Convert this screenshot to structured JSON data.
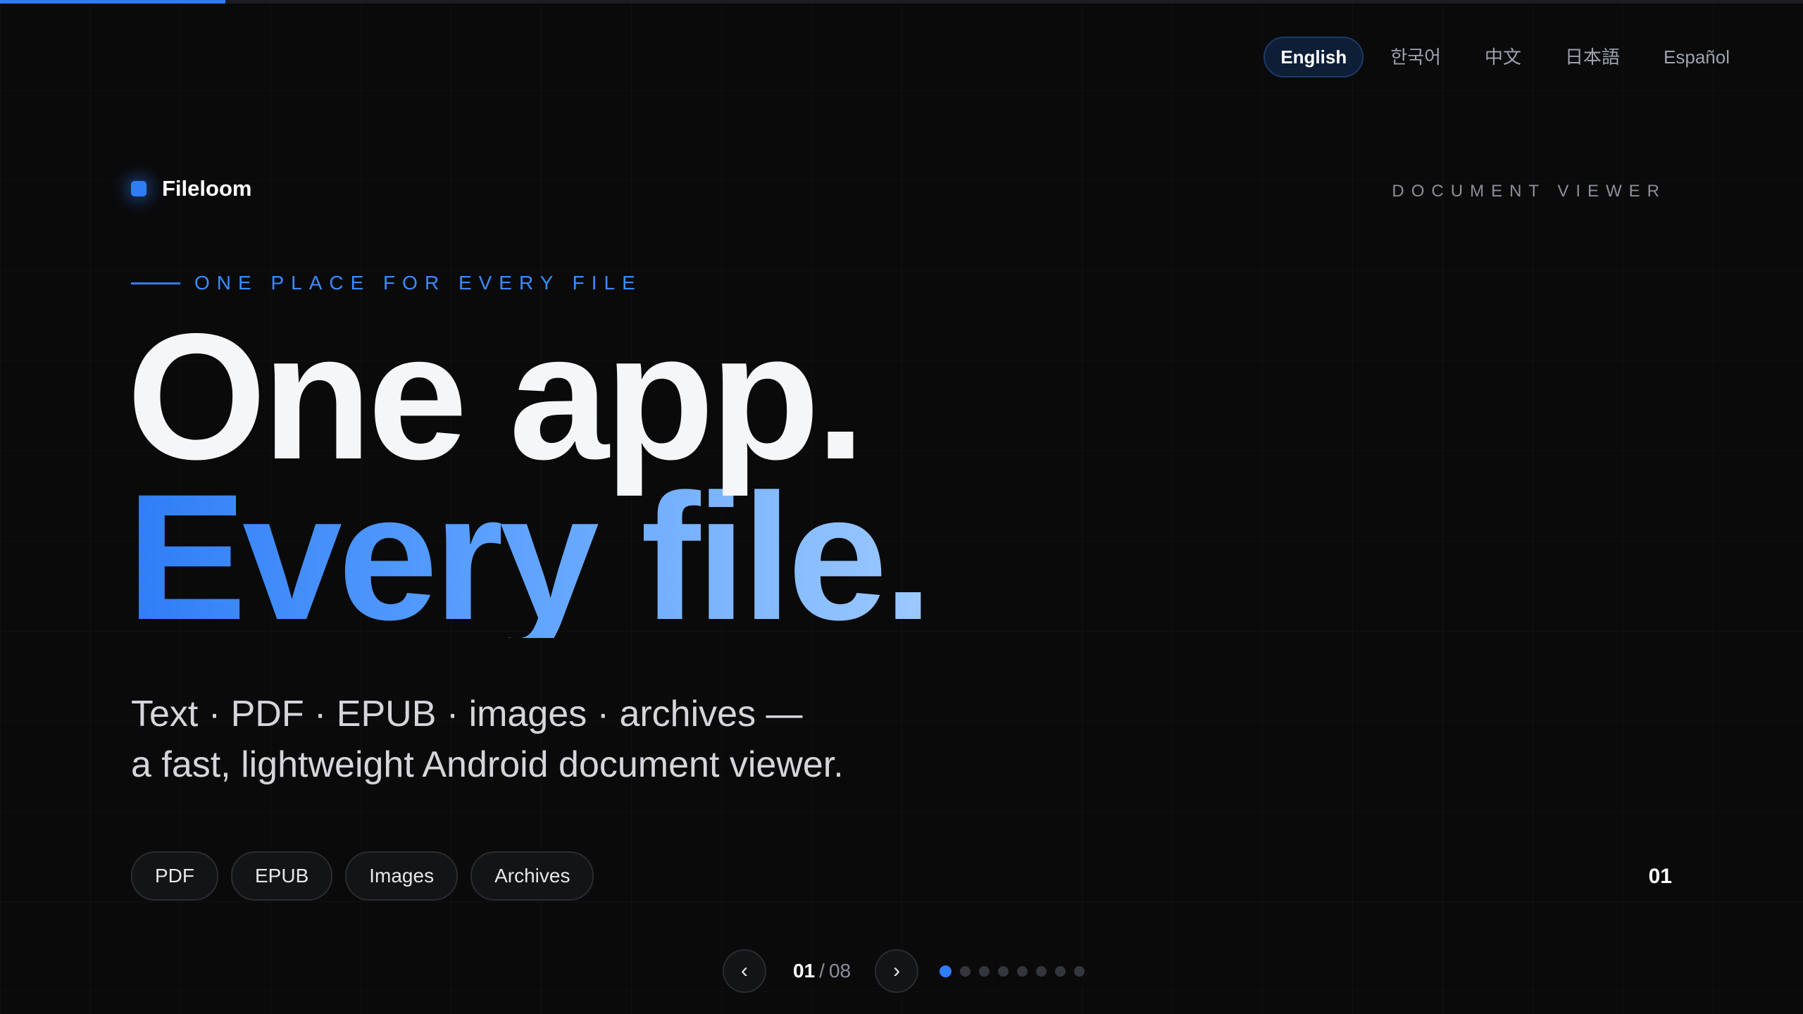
{
  "progress": {
    "fraction": 0.125
  },
  "languages": [
    {
      "label": "English",
      "active": true
    },
    {
      "label": "한국어",
      "active": false
    },
    {
      "label": "中文",
      "active": false
    },
    {
      "label": "日本語",
      "active": false
    },
    {
      "label": "Español",
      "active": false
    }
  ],
  "brand": {
    "name": "Fileloom",
    "icon": "brand-square-icon"
  },
  "kicker_right": "DOCUMENT VIEWER",
  "eyebrow": "ONE PLACE FOR EVERY FILE",
  "headline": {
    "line1": "One app.",
    "line2": "Every file."
  },
  "subtitle": {
    "line1": "Text · PDF · EPUB · images · archives —",
    "line2": "a fast, lightweight Android document viewer."
  },
  "chips": [
    "PDF",
    "EPUB",
    "Images",
    "Archives"
  ],
  "slide_number": "01",
  "pager": {
    "prev_label": "‹",
    "next_label": "›",
    "current": "01",
    "separator": "/",
    "total": "08",
    "dot_count": 8,
    "active_dot": 0
  },
  "colors": {
    "accent": "#2f7df6",
    "background": "#0a0a0b",
    "gradient_end": "#9cc9ff"
  }
}
